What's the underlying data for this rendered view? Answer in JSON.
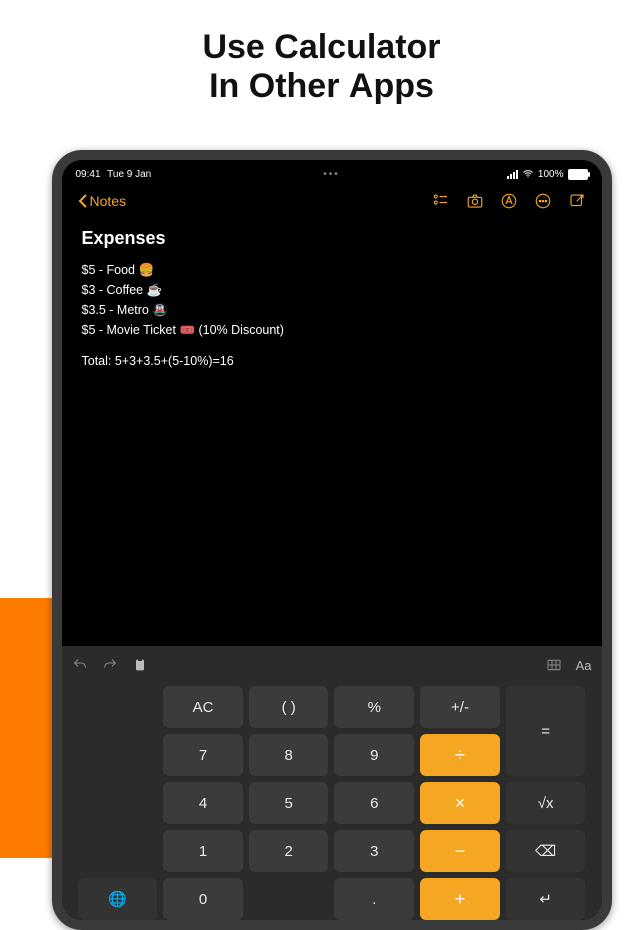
{
  "headline": {
    "l1": "Use Calculator",
    "l2a": "In Other ",
    "l2b": "Apps"
  },
  "status": {
    "time": "09:41",
    "date": "Tue 9 Jan",
    "battery": "100%"
  },
  "header": {
    "back": "Notes"
  },
  "note": {
    "title": "Expenses",
    "lines": [
      "$5 - Food 🍔",
      "$3 - Coffee ☕",
      "$3.5 - Metro 🚇",
      "$5 - Movie Ticket 🎟️ (10% Discount)"
    ],
    "total": "Total: 5+3+3.5+(5-10%)=16"
  },
  "kbtop": {
    "aa": "Aa"
  },
  "keys": {
    "ac": "AC",
    "paren": "( )",
    "pct": "%",
    "pm": "+/-",
    "eq": "=",
    "7": "7",
    "8": "8",
    "9": "9",
    "div": "÷",
    "4": "4",
    "5": "5",
    "6": "6",
    "mul": "×",
    "sqrt": "√x",
    "1": "1",
    "2": "2",
    "3": "3",
    "sub": "−",
    "del": "⌫",
    "globe": "🌐",
    "0": "0",
    "dot": ".",
    "add": "+",
    "ret": "↵"
  }
}
